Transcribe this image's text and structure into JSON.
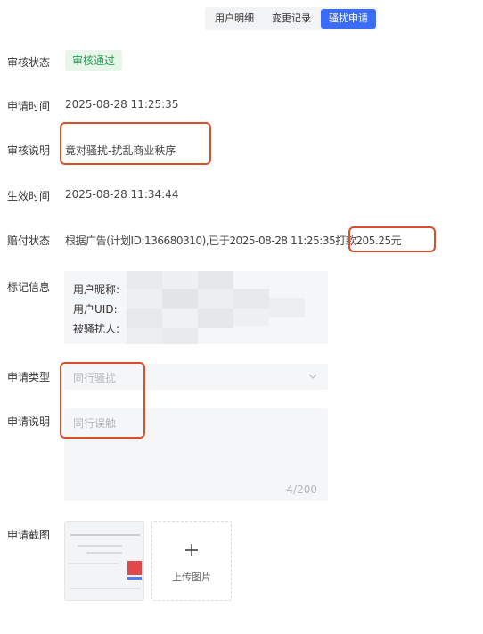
{
  "tabs": [
    {
      "label": "用户明细"
    },
    {
      "label": "变更记录"
    },
    {
      "label": "骚扰申请"
    }
  ],
  "fields": {
    "review_status": {
      "label": "审核状态",
      "value": "审核通过"
    },
    "apply_time": {
      "label": "申请时间",
      "value": "2025-08-28 11:25:35"
    },
    "review_note": {
      "label": "审核说明",
      "value": "竟对骚扰-扰乱商业秩序"
    },
    "effective_time": {
      "label": "生效时间",
      "value": "2025-08-28 11:34:44"
    },
    "compensation_status": {
      "label": "赔付状态",
      "value": "根据广告(计划ID:136680310),已于2025-08-28 11:25:35打款205.25元"
    },
    "mark_info": {
      "label": "标记信息",
      "lines": [
        "用户昵称:",
        "用户UID:",
        "被骚扰人:"
      ]
    },
    "apply_type": {
      "label": "申请类型",
      "placeholder": "同行骚扰"
    },
    "apply_note": {
      "label": "申请说明",
      "placeholder": "同行误触",
      "counter": "4/200"
    },
    "apply_screenshot": {
      "label": "申请截图",
      "upload_label": "上传图片"
    }
  },
  "colors": {
    "accent": "#3b6cf6",
    "success_bg": "#e8f6ea",
    "success_text": "#22a052",
    "annotation": "#d94f2a"
  }
}
